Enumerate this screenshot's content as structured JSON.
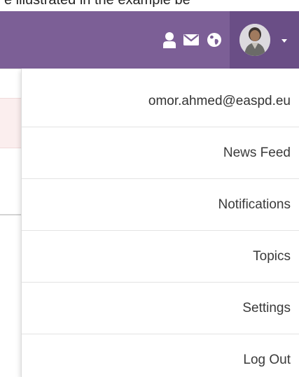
{
  "caption": "e illustrated in the example be",
  "navbar": {
    "colors": {
      "bar": "#7c5f96",
      "active": "#6a4e86",
      "icon": "#ffffff"
    },
    "icons": [
      "profile-icon",
      "mail-icon",
      "globe-icon"
    ]
  },
  "user": {
    "avatar": "avatar-icon",
    "email": "omor.ahmed@easpd.eu"
  },
  "menu": {
    "items": [
      {
        "label": "News Feed"
      },
      {
        "label": "Notifications"
      },
      {
        "label": "Topics"
      },
      {
        "label": "Settings"
      },
      {
        "label": "Log Out"
      }
    ]
  }
}
